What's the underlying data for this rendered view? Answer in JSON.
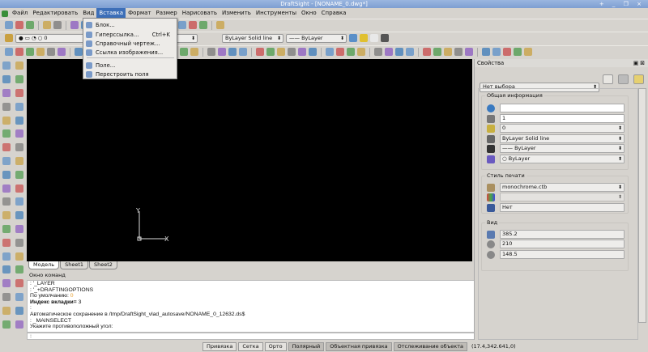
{
  "window": {
    "title": "DraftSight - [NONAME_0.dwg*]",
    "controls": "+ _ ❐ ×"
  },
  "menu": [
    {
      "label": "Файл"
    },
    {
      "label": "Редактировать"
    },
    {
      "label": "Вид"
    },
    {
      "label": "Вставка"
    },
    {
      "label": "Формат"
    },
    {
      "label": "Размер"
    },
    {
      "label": "Нарисовать"
    },
    {
      "label": "Изменить"
    },
    {
      "label": "Инструменты"
    },
    {
      "label": "Окно"
    },
    {
      "label": "Справка"
    }
  ],
  "insert_menu": [
    {
      "label": "Блок...",
      "shortcut": "",
      "icon": "block-icon"
    },
    {
      "label": "Гиперссылка...",
      "shortcut": "Ctrl+K",
      "icon": "hyperlink-icon"
    },
    {
      "label": "Справочный чертеж...",
      "shortcut": "",
      "icon": "reference-drawing-icon"
    },
    {
      "label": "Ссылка изображения...",
      "shortcut": "",
      "icon": "image-reference-icon"
    },
    {
      "label": "Поле...",
      "shortcut": "",
      "icon": "field-icon"
    },
    {
      "label": "Перестроить поля",
      "shortcut": "",
      "icon": "rebuild-fields-icon"
    }
  ],
  "toolbar": {
    "layer_value": "0",
    "linestyle_value": "ByLayer     Solid line",
    "lineweight_value": "—— ByLayer"
  },
  "colors": {
    "accent": "#3d6fb8",
    "canvas": "#000000",
    "titlebar": "#8aaad8"
  },
  "tabs": [
    {
      "label": "Модель"
    },
    {
      "label": "Sheet1"
    },
    {
      "label": "Sheet2"
    }
  ],
  "command": {
    "title": "Окно команд",
    "lines": [
      ": '_LAYER",
      ": '_+DRAFTINGOPTIONS",
      "По умолчанию: "
    ],
    "default_value": "0",
    "tab_index_label": "Индекс вкладки=",
    "tab_index_value": "3",
    "lines2": [
      ":",
      "Автоматическое сохранение в /tmp/DraftSight_vlad_autosave/NONAME_0_12632.ds$",
      ": _MAINSELECT",
      "Укажите противоположный угол:"
    ],
    "input": ":"
  },
  "status": {
    "buttons": [
      {
        "label": "Привязка",
        "on": false
      },
      {
        "label": "Сетка",
        "on": false
      },
      {
        "label": "Орто",
        "on": false
      },
      {
        "label": "Полярный",
        "on": true
      },
      {
        "label": "Объектная привязка",
        "on": true
      },
      {
        "label": "Отслеживание объекта",
        "on": true
      }
    ],
    "coords": "(17.4,342.641,0)"
  },
  "properties": {
    "title": "Свойства",
    "selection": "Нет выбора",
    "general": {
      "title": "Общая информация",
      "color": "",
      "linescale": "1",
      "layer": "0",
      "linestyle": "ByLayer     Solid line",
      "lineweight": "—— ByLayer",
      "transparency": "○ ByLayer"
    },
    "print_style": {
      "title": "Стиль печати",
      "table": "monochrome.ctb",
      "style": "",
      "attached": "Нет"
    },
    "view": {
      "title": "Вид",
      "height": "385.2",
      "center_x": "210",
      "center_y": "148.5"
    }
  }
}
